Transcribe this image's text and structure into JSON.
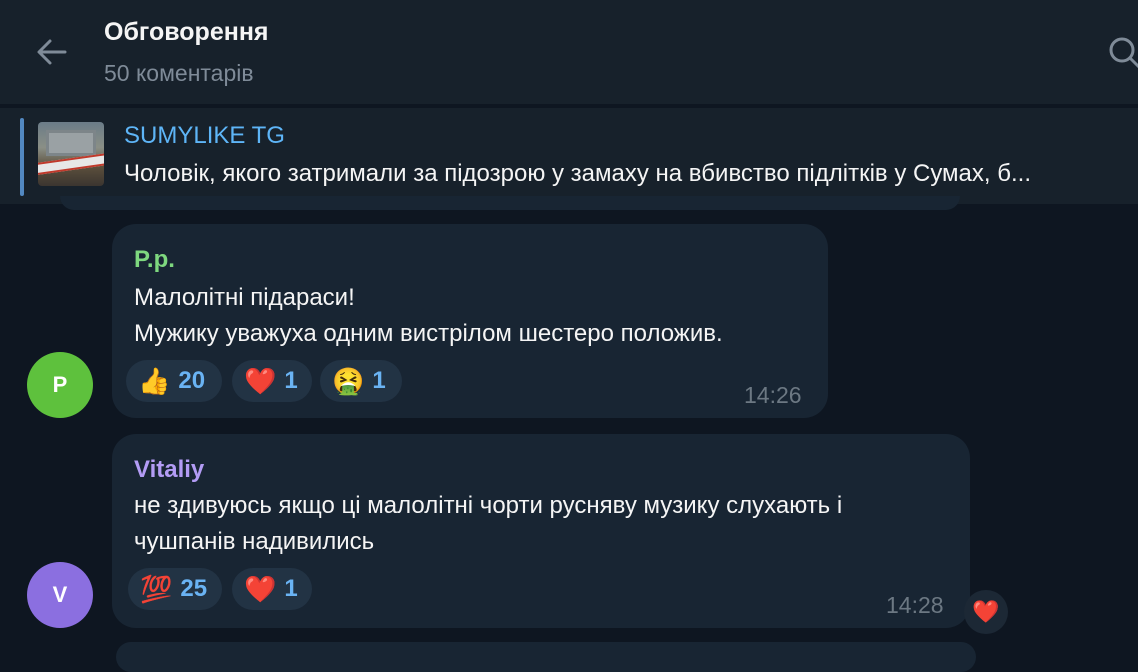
{
  "header": {
    "title": "Обговорення",
    "subtitle": "50 коментарів"
  },
  "pinned": {
    "channel": "SUMYLIKE TG",
    "text": "Чоловік, якого затримали за підозрою у замаху на вбивство підлітків у Сумах, б..."
  },
  "comments": [
    {
      "author": "P.p.",
      "author_color": "#7ed87f",
      "avatar_letter": "P",
      "avatar_color": "#5ec13d",
      "lines": [
        "Малолітні підараси!",
        "Мужику уважуха одним вистрілом шестеро положив."
      ],
      "reactions": [
        {
          "emoji": "👍",
          "count": "20"
        },
        {
          "emoji": "❤️",
          "count": "1"
        },
        {
          "emoji": "🤮",
          "count": "1"
        }
      ],
      "time": "14:26"
    },
    {
      "author": "Vitaliy",
      "author_color": "#b39cf5",
      "avatar_letter": "V",
      "avatar_color": "#8b6fe0",
      "lines": [
        "не здивуюсь якщо ці малолітні чорти русняву музику слухають і",
        "чушпанів надивились"
      ],
      "reactions": [
        {
          "emoji": "💯",
          "count": "25"
        },
        {
          "emoji": "❤️",
          "count": "1"
        }
      ],
      "time": "14:28",
      "side_reaction": "❤️"
    }
  ],
  "colors": {
    "background": "#0e1621",
    "header": "#17212b",
    "bubble": "#182533",
    "accent": "#5eb5f7",
    "reaction_count": "#6ab3f3"
  }
}
